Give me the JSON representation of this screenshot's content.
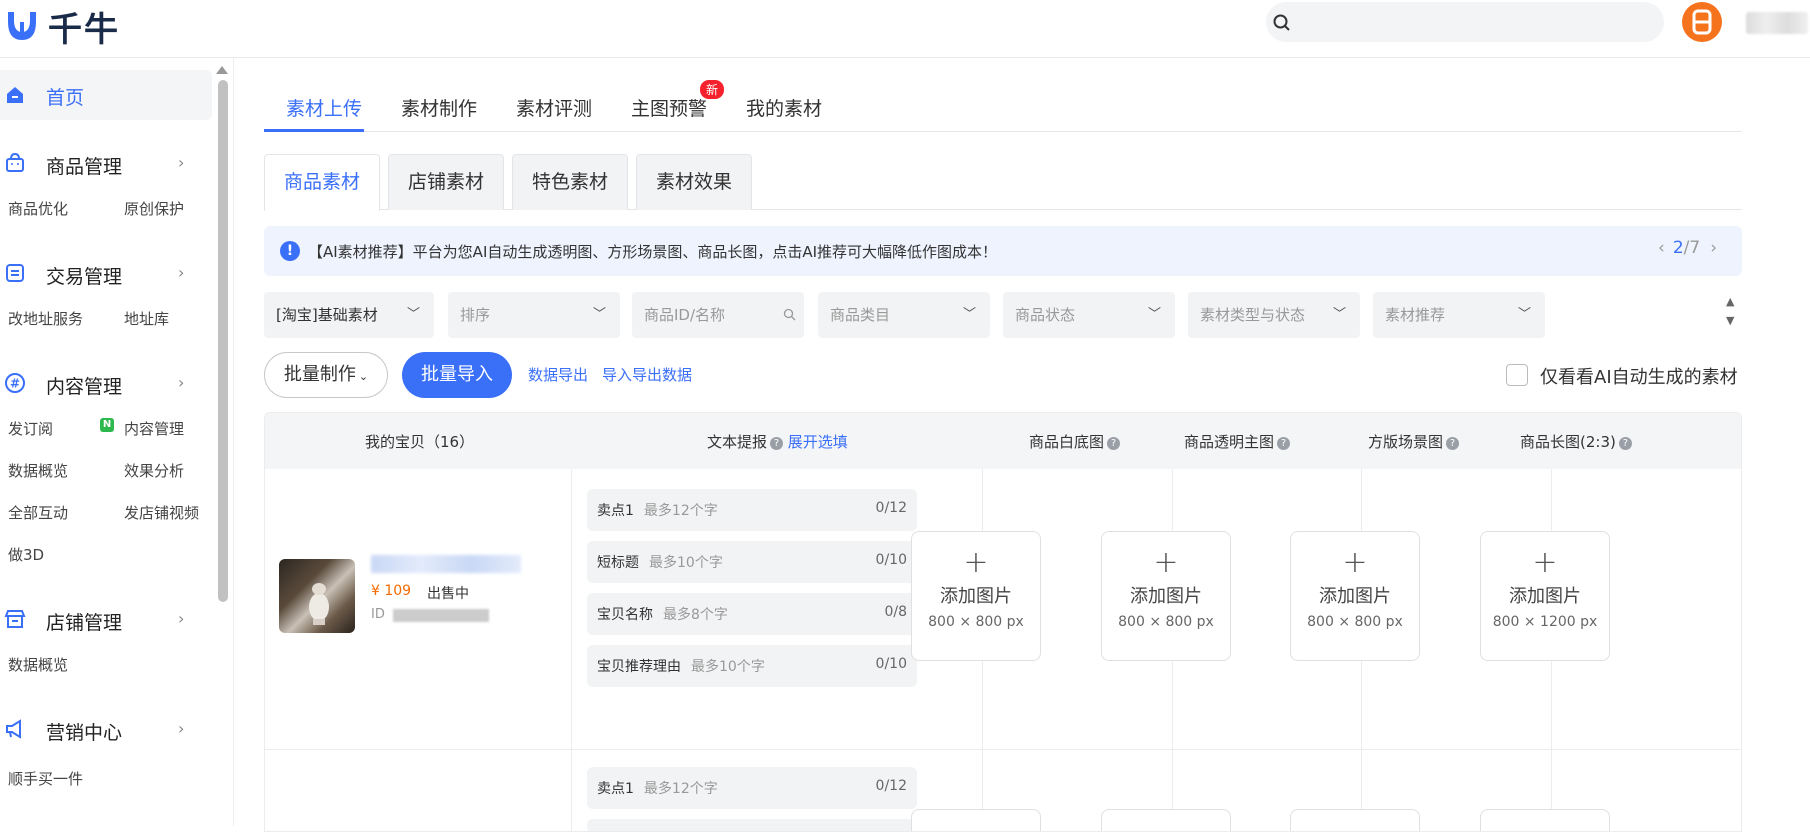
{
  "app": {
    "name": "千牛"
  },
  "search": {
    "placeholder": ""
  },
  "sidebar": {
    "home": "首页",
    "groups": [
      {
        "title": "商品管理",
        "items": [
          "商品优化",
          "原创保护"
        ]
      },
      {
        "title": "交易管理",
        "items": [
          "改地址服务",
          "地址库"
        ]
      },
      {
        "title": "内容管理",
        "items": [
          "发订阅",
          "内容管理",
          "数据概览",
          "效果分析",
          "全部互动",
          "发店铺视频",
          "做3D"
        ],
        "badge": "N"
      },
      {
        "title": "店铺管理",
        "items": [
          "数据概览"
        ]
      },
      {
        "title": "营销中心",
        "items": [
          "顺手买一件"
        ]
      }
    ]
  },
  "tabs": [
    "素材上传",
    "素材制作",
    "素材评测",
    "主图预警",
    "我的素材"
  ],
  "new_badge": "新",
  "subtabs": [
    "商品素材",
    "店铺素材",
    "特色素材",
    "素材效果"
  ],
  "notice": {
    "icon": "!",
    "text": "【AI素材推荐】平台为您AI自动生成透明图、方形场景图、商品长图，点击AI推荐可大幅降低作图成本！",
    "page_current": "2",
    "page_total": "/7"
  },
  "filters": [
    "[淘宝]基础素材",
    "排序",
    "商品ID/名称",
    "商品类目",
    "商品状态",
    "素材类型与状态",
    "素材推荐"
  ],
  "actions": {
    "batch_make": "批量制作",
    "batch_import": "批量导入",
    "data_export": "数据导出",
    "import_export_data": "导入导出数据",
    "only_ai_label": "仅看看AI自动生成的素材"
  },
  "table": {
    "headers": {
      "my_items": "我的宝贝（16）",
      "text_hint": "文本提报",
      "expand": "展开选填",
      "white_bg": "商品白底图",
      "transparent": "商品透明主图",
      "square_scene": "方版场景图",
      "long_img": "商品长图(2:3)"
    },
    "row": {
      "price": "¥ 109",
      "status": "出售中",
      "id_label": "ID",
      "fields": [
        {
          "label": "卖点1",
          "placeholder": "最多12个字",
          "count": "0/12"
        },
        {
          "label": "短标题",
          "placeholder": "最多10个字",
          "count": "0/10"
        },
        {
          "label": "宝贝名称",
          "placeholder": "最多8个字",
          "count": "0/8"
        },
        {
          "label": "宝贝推荐理由",
          "placeholder": "最多10个字",
          "count": "0/10"
        }
      ],
      "uploads": [
        {
          "label": "添加图片",
          "size": "800 × 800 px"
        },
        {
          "label": "添加图片",
          "size": "800 × 800 px"
        },
        {
          "label": "添加图片",
          "size": "800 × 800 px"
        },
        {
          "label": "添加图片",
          "size": "800 × 1200 px"
        }
      ]
    },
    "row2": {
      "field": {
        "label": "卖点1",
        "placeholder": "最多12个字",
        "count": "0/12"
      }
    }
  },
  "colors": {
    "accent": "#3a6ff7",
    "price": "#f56a00",
    "avatar": "#f5731d",
    "new_badge": "#f5222d"
  }
}
